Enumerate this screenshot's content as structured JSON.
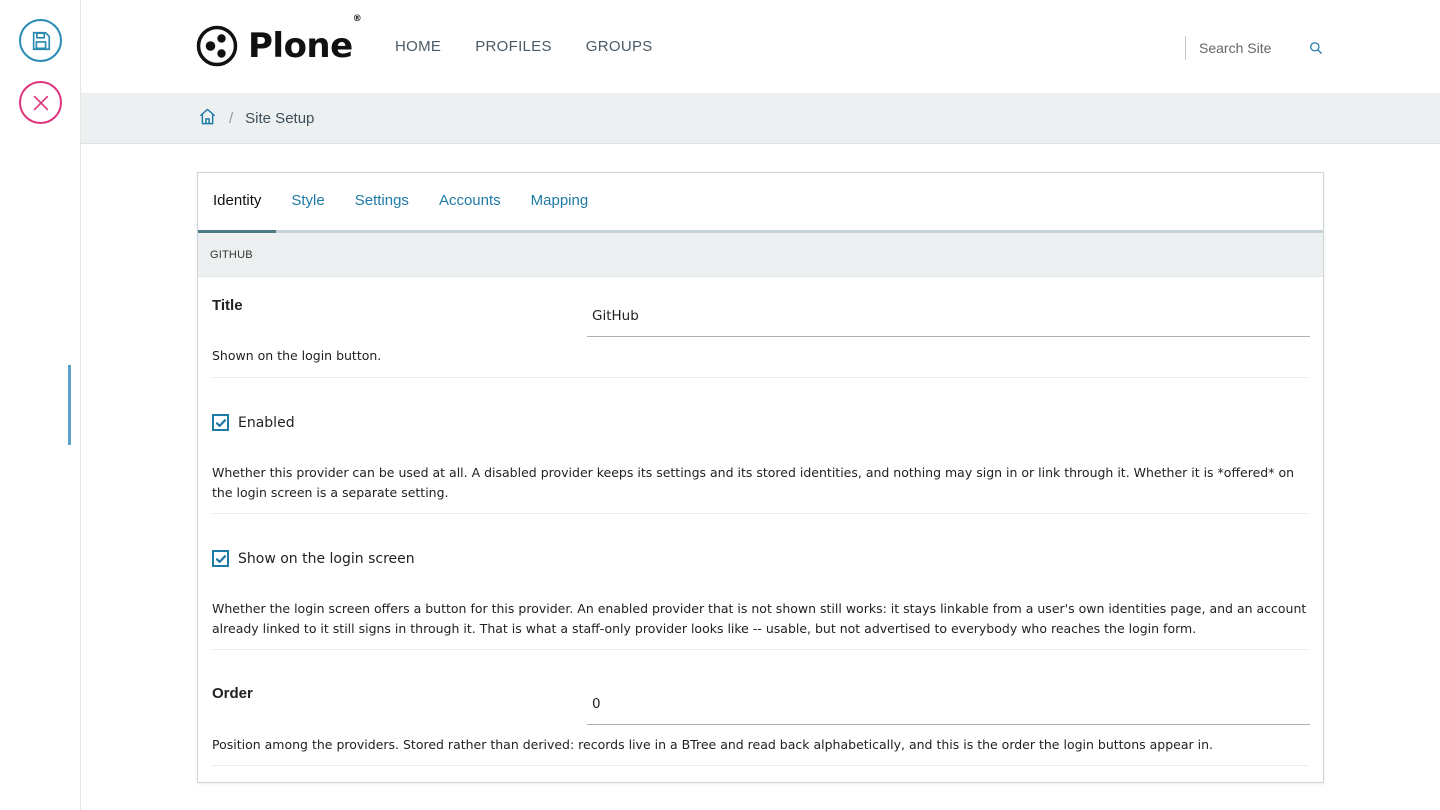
{
  "header": {
    "logo_text": "Plone",
    "logo_reg": "®",
    "nav": [
      "HOME",
      "PROFILES",
      "GROUPS"
    ],
    "search_placeholder": "Search Site"
  },
  "breadcrumb": {
    "separator": "/",
    "current": "Site Setup"
  },
  "tabs": [
    {
      "label": "Identity",
      "active": true
    },
    {
      "label": "Style",
      "active": false
    },
    {
      "label": "Settings",
      "active": false
    },
    {
      "label": "Accounts",
      "active": false
    },
    {
      "label": "Mapping",
      "active": false
    }
  ],
  "section": {
    "title": "GITHUB"
  },
  "fields": {
    "title": {
      "label": "Title",
      "value": "GitHub",
      "help": "Shown on the login button."
    },
    "enabled": {
      "label": "Enabled",
      "checked": true,
      "help": "Whether this provider can be used at all. A disabled provider keeps its settings and its stored identities, and nothing may sign in or link through it. Whether it is *offered* on the login screen is a separate setting."
    },
    "show_on_login": {
      "label": "Show on the login screen",
      "checked": true,
      "help": "Whether the login screen offers a button for this provider. An enabled provider that is not shown still works: it stays linkable from a user's own identities page, and an account already linked to it still signs in through it. That is what a staff-only provider looks like -- usable, but not advertised to everybody who reaches the login form."
    },
    "order": {
      "label": "Order",
      "value": "0",
      "help": "Position among the providers. Stored rather than derived: records live in a BTree and read back alphabetically, and this is the order the login buttons appear in."
    }
  },
  "colors": {
    "accent_blue": "#1e7aa6",
    "cancel_pink": "#e0357e",
    "save_blue": "#2a8ab1",
    "crumb_bg": "#ecf0f1"
  },
  "icons": [
    "save-icon",
    "close-icon",
    "search-icon",
    "home-icon",
    "checkmark-icon",
    "plone-logo-icon"
  ]
}
